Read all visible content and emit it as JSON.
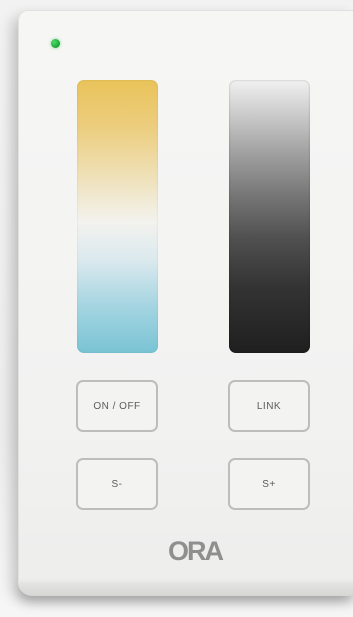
{
  "controls": {
    "on_off_label": "ON / OFF",
    "link_label": "LINK",
    "scene_minus_label": "S-",
    "scene_plus_label": "S+"
  },
  "brand": {
    "logo_text": "ORA"
  },
  "colors": {
    "status_led": "#2bbf4a",
    "warm_end": "#e9c35a",
    "cool_end": "#79c3d4",
    "bright_end": "#f1f1f1",
    "dark_end": "#1f1f1f"
  },
  "icons": {
    "status_indicator": "status-led-icon"
  }
}
